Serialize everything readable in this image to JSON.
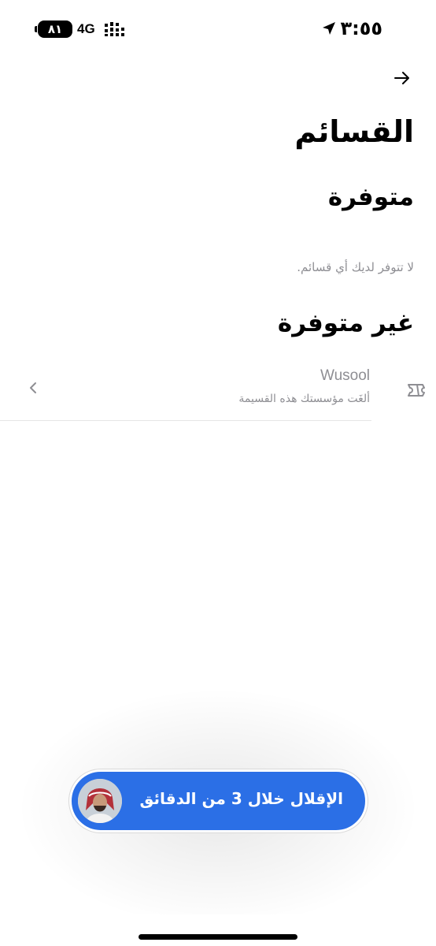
{
  "status_bar": {
    "battery": "٨١",
    "network": "4G",
    "time": "٣:٥٥"
  },
  "header": {
    "title": "القسائم"
  },
  "available": {
    "title": "متوفرة",
    "empty_text": "لا تتوفر لديك أي قسائم."
  },
  "unavailable": {
    "title": "غير متوفرة",
    "items": [
      {
        "name": "Wusool",
        "subtitle": "ألغَت مؤسستك هذه القسيمة"
      }
    ]
  },
  "toast": {
    "text": "الإقلال خلال 3 من الدقائق"
  },
  "colors": {
    "toast_bg": "#2b6fe6",
    "muted_text": "#8e8e93"
  },
  "icons": {
    "back": "arrow-right-icon",
    "ticket": "ticket-icon",
    "chevron": "chevron-left-icon",
    "location": "location-arrow-icon"
  }
}
